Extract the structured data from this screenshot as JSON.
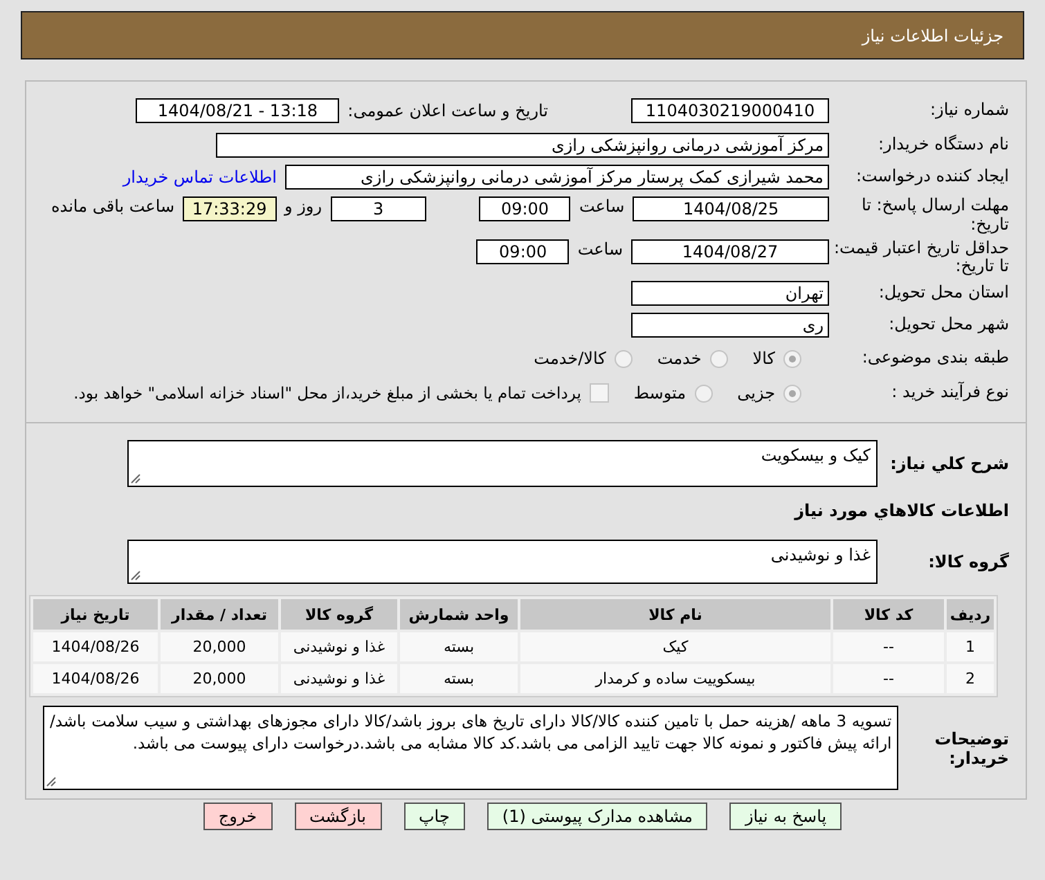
{
  "header": {
    "title": "جزئیات اطلاعات نیاز"
  },
  "need_number": {
    "label": "شماره نیاز:",
    "value": "1104030219000410"
  },
  "announce": {
    "label": "تاریخ و ساعت اعلان عمومی:",
    "value": "1404/08/21 - 13:18"
  },
  "buyer": {
    "label": "نام دستگاه خریدار:",
    "value": "مرکز آموزشی درمانی روانپزشکی رازی"
  },
  "requester": {
    "label": "ایجاد کننده درخواست:",
    "value": "محمد شیرازی کمک پرستار مرکز آموزشی درمانی روانپزشکی رازی",
    "link": "اطلاعات تماس خریدار"
  },
  "reply_deadline": {
    "label": "مهلت ارسال پاسخ: تا تاریخ:",
    "date": "1404/08/25",
    "time_label": "ساعت",
    "time": "09:00",
    "days": "3",
    "days_label": "روز و",
    "remaining": "17:33:29",
    "remaining_label": "ساعت باقی مانده"
  },
  "price_validity": {
    "label": "حداقل تاریخ اعتبار قیمت: تا تاریخ:",
    "date": "1404/08/27",
    "time_label": "ساعت",
    "time": "09:00"
  },
  "province": {
    "label": "استان محل تحویل:",
    "value": "تهران"
  },
  "city": {
    "label": "شهر محل تحویل:",
    "value": "ری"
  },
  "category": {
    "label": "طبقه بندی موضوعی:",
    "options": [
      {
        "label": "کالا",
        "selected": true
      },
      {
        "label": "خدمت",
        "selected": false
      },
      {
        "label": "کالا/خدمت",
        "selected": false
      }
    ]
  },
  "purchase_type": {
    "label": "نوع فرآیند خرید :",
    "options": [
      {
        "label": "جزیی",
        "selected": true
      },
      {
        "label": "متوسط",
        "selected": false
      }
    ],
    "payment": {
      "checked": false,
      "text": "پرداخت تمام یا بخشی از مبلغ خرید،از محل \"اسناد خزانه اسلامی\" خواهد بود."
    }
  },
  "summary": {
    "label": "شرح کلي نیاز:",
    "value": "کیک و بیسکویت"
  },
  "goods_heading": "اطلاعات کالاهاي مورد نیاز",
  "goods_group": {
    "label": "گروه کالا:",
    "value": "غذا و نوشیدنی"
  },
  "table": {
    "columns": [
      "ردیف",
      "کد کالا",
      "نام کالا",
      "واحد شمارش",
      "گروه کالا",
      "تعداد / مقدار",
      "تاریخ نیاز"
    ],
    "rows": [
      [
        "1",
        "--",
        "کیک",
        "بسته",
        "غذا و نوشیدنی",
        "20,000",
        "1404/08/26"
      ],
      [
        "2",
        "--",
        "بیسکوییت ساده و کرمدار",
        "بسته",
        "غذا و نوشیدنی",
        "20,000",
        "1404/08/26"
      ]
    ]
  },
  "notes": {
    "label": "توضیحات خریدار:",
    "value": "تسویه 3 ماهه /هزینه حمل با تامین کننده کالا/کالا دارای تاریخ های بروز باشد/کالا دارای مجوزهای بهداشتی و سیب سلامت باشد/ارائه پیش فاکتور و نمونه کالا جهت تایید الزامی می باشد.کد کالا مشابه می باشد.درخواست دارای پیوست می باشد."
  },
  "buttons": [
    {
      "label": "پاسخ به نیاز",
      "kind": "action"
    },
    {
      "label": "مشاهده مدارک پیوستی (1)",
      "kind": "action"
    },
    {
      "label": "چاپ",
      "kind": "action"
    },
    {
      "label": "بازگشت",
      "kind": "leave"
    },
    {
      "label": "خروج",
      "kind": "leave"
    }
  ]
}
